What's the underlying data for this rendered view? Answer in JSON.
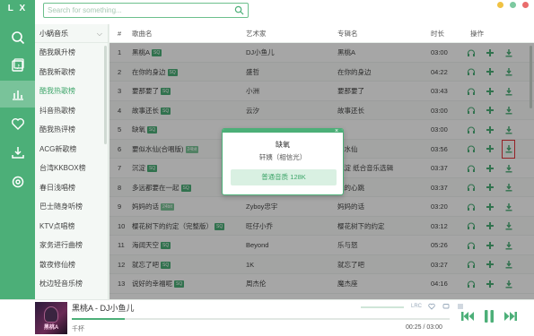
{
  "app": {
    "logo": "L X"
  },
  "search": {
    "placeholder": "Search for something..."
  },
  "colors": {
    "accent": "#4caf78",
    "highlight": "#e3353b"
  },
  "sidebar": {
    "icons": [
      "search-icon",
      "music-library-icon",
      "chart-icon",
      "heart-icon",
      "download-icon",
      "settings-icon"
    ]
  },
  "list_panel": {
    "source": "小蜗音乐",
    "items": [
      "酷我飙升榜",
      "酷我新歌榜",
      "酷我热歌榜",
      "抖音热歌榜",
      "酷我热评榜",
      "ACG新歌榜",
      "台湾KKBOX榜",
      "春日浅唱榜",
      "巴士随身听榜",
      "KTV点唱榜",
      "家务进行曲榜",
      "散夜修仙榜",
      "枕边轻音乐榜"
    ],
    "active_index": 2
  },
  "table": {
    "headers": {
      "num": "#",
      "title": "歌曲名",
      "artist": "艺术家",
      "album": "专辑名",
      "duration": "时长",
      "actions": "操作"
    },
    "rows": [
      {
        "num": "1",
        "title": "黑桃A",
        "badge": "SQ",
        "artist": "DJ小鱼儿",
        "album": "黑桃A",
        "duration": "03:00"
      },
      {
        "num": "2",
        "title": "在你的身边",
        "badge": "SQ",
        "artist": "盛哲",
        "album": "在你的身边",
        "duration": "04:22"
      },
      {
        "num": "3",
        "title": "要那要了",
        "badge": "SQ",
        "artist": "小洲",
        "album": "要那要了",
        "duration": "03:43"
      },
      {
        "num": "4",
        "title": "故事还长",
        "badge": "SQ",
        "artist": "云汐",
        "album": "故事还长",
        "duration": "03:00"
      },
      {
        "num": "5",
        "title": "缺氧",
        "badge": "SQ",
        "artist": "",
        "album": "",
        "duration": "03:00"
      },
      {
        "num": "6",
        "title": "要似水仙(合唱版)",
        "badge": "24bit",
        "artist": "",
        "album": "似水仙",
        "duration": "03:56"
      },
      {
        "num": "7",
        "title": "沉淀",
        "badge": "SQ",
        "artist": "",
        "album": "沉淀 纸合音乐选辑",
        "duration": "03:37"
      },
      {
        "num": "8",
        "title": "多远都要在一起",
        "badge": "SQ",
        "artist": "",
        "album": "我的心跳",
        "duration": "03:37"
      },
      {
        "num": "9",
        "title": "妈妈的话",
        "badge": "24bit",
        "artist": "Zyboy忠宇",
        "album": "妈妈的话",
        "duration": "03:20"
      },
      {
        "num": "10",
        "title": "樱花树下的约定（完整版）",
        "badge": "SQ",
        "artist": "旺仔小乔",
        "album": "樱花树下的约定",
        "duration": "03:12"
      },
      {
        "num": "11",
        "title": "海阔天空",
        "badge": "SQ",
        "artist": "Beyond",
        "album": "乐与怒",
        "duration": "05:26"
      },
      {
        "num": "12",
        "title": "就忘了吧",
        "badge": "SQ",
        "artist": "1K",
        "album": "就忘了吧",
        "duration": "03:27"
      },
      {
        "num": "13",
        "title": "说好的幸福呢",
        "badge": "SQ",
        "artist": "周杰伦",
        "album": "魔杰座",
        "duration": "04:16"
      }
    ],
    "highlight_row_index": 5
  },
  "popup": {
    "title": "缺氧",
    "subtitle": "轩姨（相信光）",
    "option": "普通音质 128K"
  },
  "player": {
    "cover_text": "黑桃A",
    "title": "黑桃A - DJ小鱼儿",
    "lyric": "千杯",
    "lrc": "LRC",
    "time": "00:25 / 03:00",
    "progress_fraction": 0.139
  }
}
